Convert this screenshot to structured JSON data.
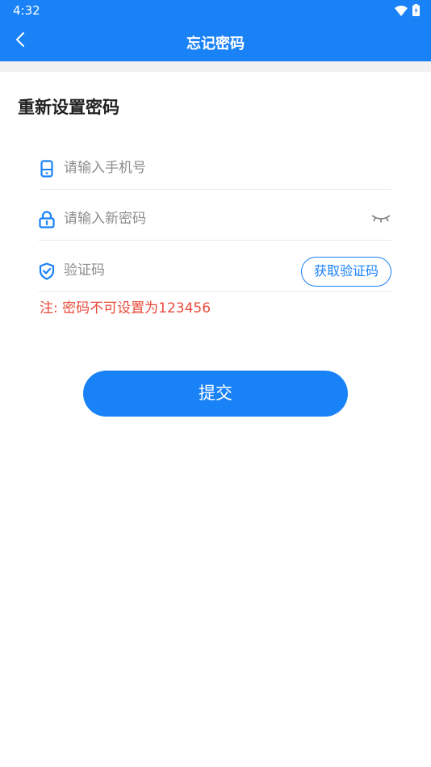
{
  "status_bar": {
    "time": "4:32",
    "icons": [
      "wifi-icon",
      "battery-icon"
    ]
  },
  "app_bar": {
    "back_icon": "chevron-left-icon",
    "title": "忘记密码"
  },
  "form": {
    "section_title": "重新设置密码",
    "phone": {
      "icon": "phone-icon",
      "placeholder": "请输入手机号",
      "value": ""
    },
    "password": {
      "icon": "lock-icon",
      "placeholder": "请输入新密码",
      "value": "",
      "toggle_icon": "eye-closed-icon"
    },
    "code": {
      "icon": "shield-check-icon",
      "placeholder": "验证码",
      "value": "",
      "get_code_label": "获取验证码"
    },
    "note": "注: 密码不可设置为123456",
    "submit_label": "提交"
  },
  "colors": {
    "primary": "#1a82f7",
    "warning": "#e84a3b",
    "placeholder": "#8d8d8d"
  }
}
